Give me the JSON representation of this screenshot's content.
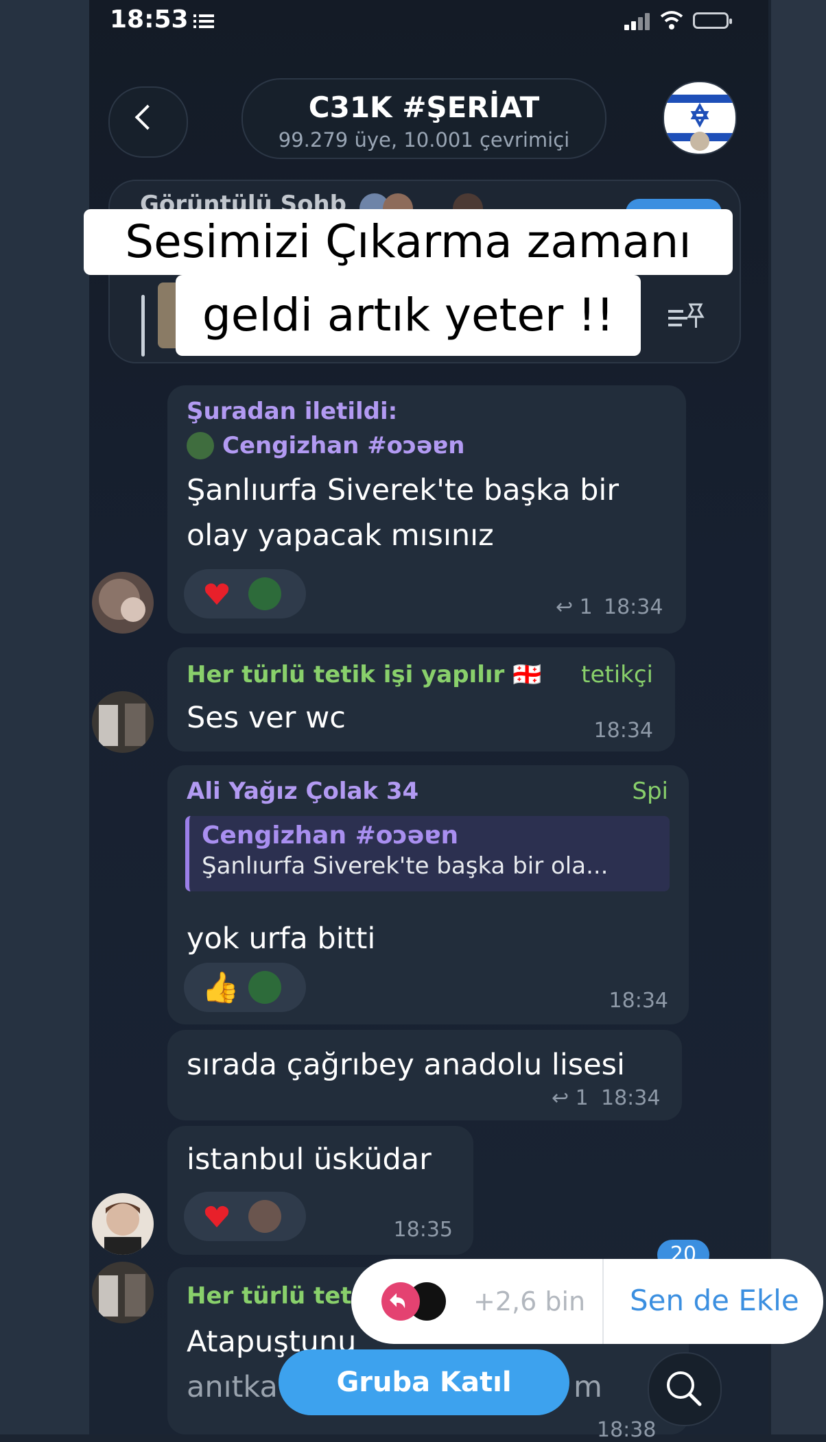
{
  "status_bar": {
    "time": "18:53"
  },
  "header": {
    "title": "C31K #ŞERİAT",
    "subtitle": "99.279 üye, 10.001 çevrimiçi"
  },
  "pinned": {
    "partial_text": "Görüntülü Sohb"
  },
  "caption": {
    "line1": "Sesimizi Çıkarma zamanı",
    "line2": "geldi artık yeter !!"
  },
  "messages": [
    {
      "forwarded_label": "Şuradan iletildi:",
      "forwarded_from": "Cengizhan #oɔəɐn",
      "text_line1": "Şanlıurfa Siverek'te başka bir",
      "text_line2": "olay yapacak mısınız",
      "reply_count": "↩ 1",
      "time": "18:34"
    },
    {
      "sender": "Her türlü tetik işi yapılır 🇬🇪",
      "role": "tetikçi",
      "text": "Ses ver wc",
      "time": "18:34"
    },
    {
      "sender": "Ali Yağız Çolak 34",
      "role": "Spi",
      "quote_author": "Cengizhan #oɔəɐn",
      "quote_text": "Şanlıurfa Siverek'te başka bir ola...",
      "text": "yok urfa bitti",
      "reaction_emoji": "👍",
      "time": "18:34"
    },
    {
      "text": "sırada çağrıbey anadolu lisesi",
      "reply_count": "↩ 1",
      "time": "18:34"
    },
    {
      "text": "istanbul üsküdar",
      "time": "18:35"
    },
    {
      "sender": "Her türlü tet",
      "text_line1": "Atapuştunu",
      "text_line2": "anıtka",
      "text_suffix": "m",
      "time": "18:38"
    }
  ],
  "join_overlay": {
    "count": "+2,6 bin",
    "add_label": "Sen de Ekle",
    "unread": "20"
  },
  "bottom": {
    "join_label": "Gruba Katıl"
  },
  "colors": {
    "accent": "#3da2ee",
    "sender_purple": "#b29af2",
    "sender_green": "#89d06b",
    "bubble": "#222d3b"
  }
}
